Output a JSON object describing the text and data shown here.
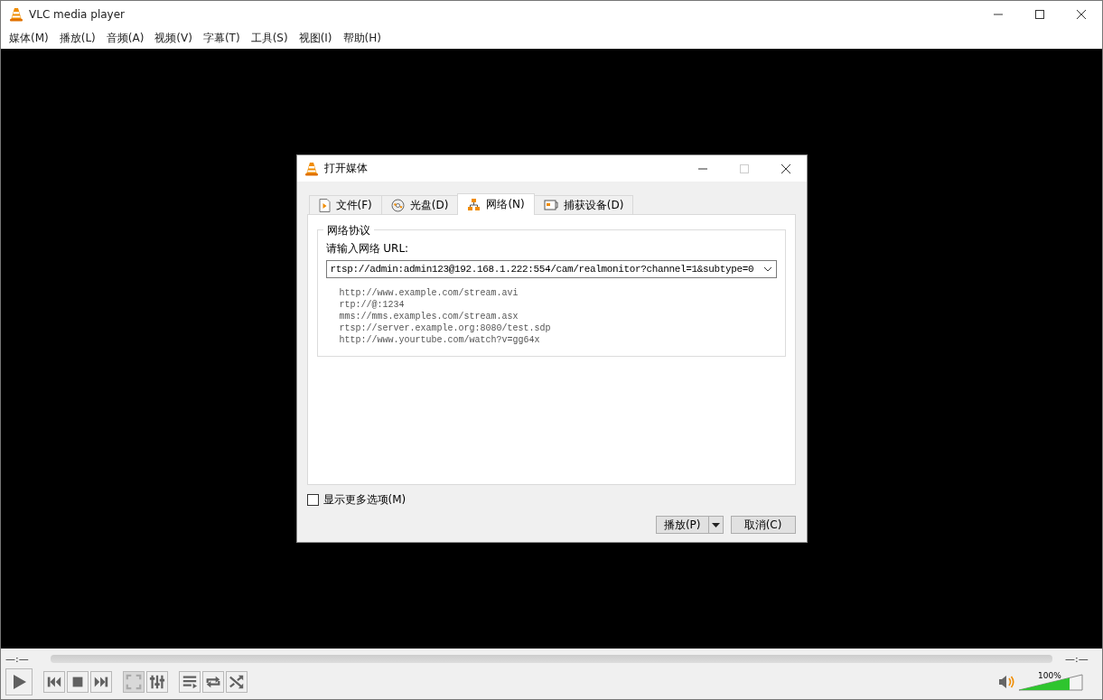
{
  "window": {
    "title": "VLC media player"
  },
  "menu": [
    "媒体(M)",
    "播放(L)",
    "音频(A)",
    "视频(V)",
    "字幕(T)",
    "工具(S)",
    "视图(I)",
    "帮助(H)"
  ],
  "dialog": {
    "title": "打开媒体",
    "tabs": [
      {
        "label": "文件(F)",
        "kind": "file",
        "selected": false
      },
      {
        "label": "光盘(D)",
        "kind": "disc",
        "selected": false
      },
      {
        "label": "网络(N)",
        "kind": "network",
        "selected": true
      },
      {
        "label": "捕获设备(D)",
        "kind": "capture",
        "selected": false
      }
    ],
    "group_title": "网络协议",
    "url_label": "请输入网络 URL:",
    "url_value": "rtsp://admin:admin123@192.168.1.222:554/cam/realmonitor?channel=1&subtype=0",
    "examples": [
      "http://www.example.com/stream.avi",
      "rtp://@:1234",
      "mms://mms.examples.com/stream.asx",
      "rtsp://server.example.org:8080/test.sdp",
      "http://www.yourtube.com/watch?v=gg64x"
    ],
    "more_options": {
      "label": "显示更多选项(M)",
      "checked": false
    },
    "play_button": "播放(P)",
    "cancel_button": "取消(C)"
  },
  "player": {
    "time_elapsed": "—:—",
    "time_total": "—:—",
    "control_groups": [
      [
        {
          "kind": "play",
          "disabled": false
        }
      ],
      [
        {
          "kind": "previous",
          "disabled": false
        },
        {
          "kind": "stop",
          "disabled": false
        },
        {
          "kind": "next",
          "disabled": false
        }
      ],
      [
        {
          "kind": "fullscreen",
          "disabled": true
        },
        {
          "kind": "equalizer",
          "disabled": false
        }
      ],
      [
        {
          "kind": "playlist",
          "disabled": false
        },
        {
          "kind": "loop",
          "disabled": false
        },
        {
          "kind": "shuffle",
          "disabled": false
        }
      ]
    ],
    "volume": {
      "reading": "100%",
      "level": 0.8
    }
  }
}
